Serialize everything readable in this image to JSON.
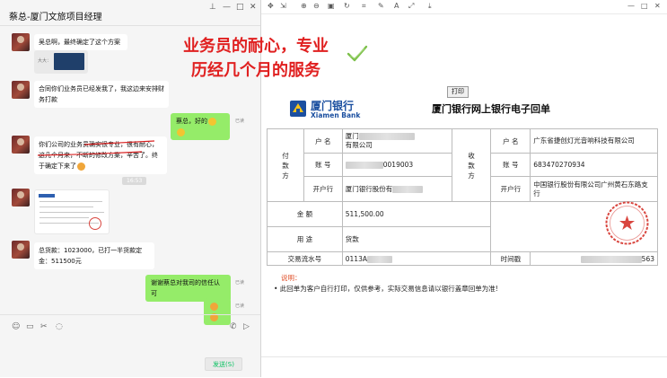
{
  "chat": {
    "window_title": "蔡总-厦门文旅项目经理",
    "window_controls": {
      "pin": "⊥",
      "minimize": "—",
      "maximize": "□",
      "close": "✕"
    },
    "messages": [
      {
        "side": "left",
        "text": "吴总啊，最终确定了这个方案"
      },
      {
        "side": "left",
        "kind": "image-preview",
        "caption": "大大："
      },
      {
        "side": "left",
        "text": "合同你们业务员已经发我了，我这边来安排财务打款"
      },
      {
        "side": "right",
        "text": "蔡总，好的",
        "tag": "已读"
      },
      {
        "side": "left",
        "text": "你们公司的业务员确实很专业，很有耐心，这几个月来，不断的修改方案，辛苦了。终于确定下来了"
      },
      {
        "side": "left",
        "kind": "document-preview"
      },
      {
        "side": "left",
        "text": "总货款：1023000，已打一半货款定金：511500元"
      },
      {
        "side": "right",
        "text": "谢谢蔡总对我司的信任认可",
        "tag": "已读"
      },
      {
        "side": "right",
        "kind": "emoji",
        "tag": "已读"
      }
    ],
    "timestamp": "16:53",
    "toolbar_icons": [
      "emoji-icon",
      "folder-icon",
      "scissors-icon",
      "chat-history-icon",
      "phone-icon",
      "video-icon"
    ],
    "send_label": "发送(S)"
  },
  "overlay": {
    "line1": "业务员的耐心，专业",
    "line2": "历经几个月的服务",
    "check_color": "#7cc04a",
    "text_color": "#e02020"
  },
  "viewer": {
    "toolbar_icons": [
      "pan-icon",
      "zoom-in-icon",
      "zoom-out-icon",
      "fit-icon",
      "rotate-icon",
      "crop-icon",
      "edit-icon",
      "fullscreen-icon",
      "save-icon"
    ],
    "window_controls": {
      "minimize": "—",
      "maximize": "□",
      "close": "✕"
    },
    "print_label": "打印",
    "bank_name_cn": "厦门银行",
    "bank_name_en": "Xiamen Bank",
    "receipt_title": "厦门银行网上银行电子回单",
    "payer": {
      "section_label": "付款方",
      "name_label": "户  名",
      "name_value_line1": "厦门",
      "name_value_line2": "有限公司",
      "account_label": "账  号",
      "account_value": "0019003",
      "bank_label": "开户行",
      "bank_value": "厦门银行股份有"
    },
    "payee": {
      "section_label": "收款方",
      "name_label": "户  名",
      "name_value": "广东省捷创灯光音响科技有限公司",
      "account_label": "账  号",
      "account_value": "683470270934",
      "bank_label": "开户行",
      "bank_value": "中国银行股份有限公司广州黄石东路支行"
    },
    "amount_label": "金  额",
    "amount_value": "511,500.00",
    "purpose_label": "用  途",
    "purpose_value": "货款",
    "serial_label": "交易流水号",
    "serial_value": "0113A",
    "time_label": "时间戳",
    "time_value": "563",
    "note_label": "说明：",
    "note_text": "• 此回单为客户自行打印，仅供参考，实际交易信息请以银行盖章回单为准!",
    "stamp_color": "#d9463f"
  }
}
